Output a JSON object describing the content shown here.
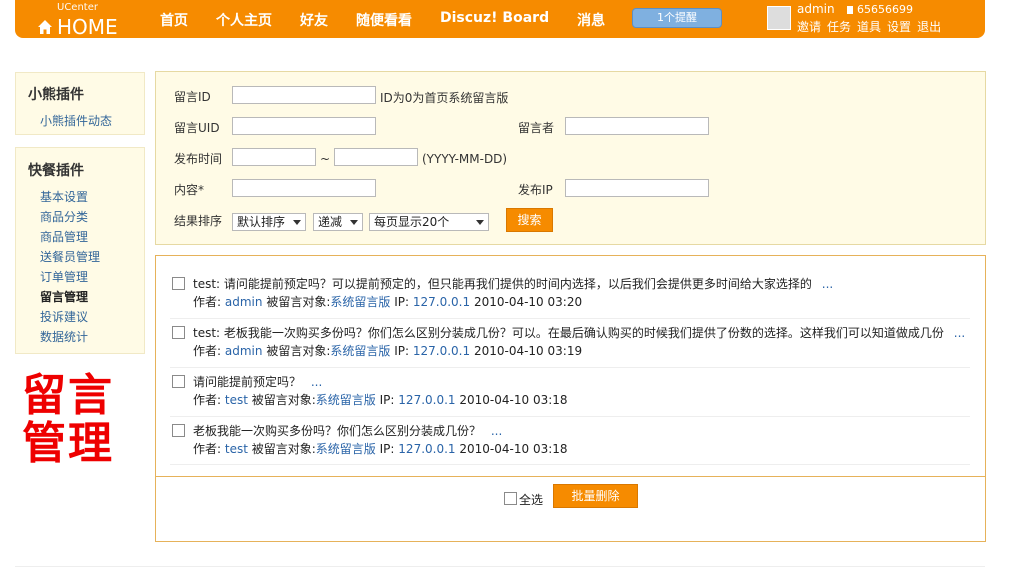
{
  "topbar": {
    "logo_small": "UCenter",
    "logo_big": "HOME",
    "nav": [
      "首页",
      "个人主页",
      "好友",
      "随便看看",
      "Discuz! Board",
      "消息"
    ],
    "notify": "1个提醒",
    "username": "admin",
    "credit": "65656699",
    "user_links": [
      "邀请",
      "任务",
      "道具",
      "设置",
      "退出"
    ]
  },
  "sidebar": {
    "box1_title": "小熊插件",
    "box1_items": [
      "小熊插件动态"
    ],
    "box2_title": "快餐插件",
    "box2_items": [
      "基本设置",
      "商品分类",
      "商品管理",
      "送餐员管理",
      "订单管理",
      "留言管理",
      "投诉建议",
      "数据统计"
    ],
    "active_item": "留言管理",
    "big_text_line1": "留言",
    "big_text_line2": "管理"
  },
  "search": {
    "msg_id_label": "留言ID",
    "msg_id_value": "",
    "msg_id_hint": "ID为0为首页系统留言版",
    "msg_uid_label": "留言UID",
    "msg_uid_value": "",
    "author_label": "留言者",
    "author_value": "",
    "time_label": "发布时间",
    "time_from": "",
    "time_sep": "~",
    "time_to": "",
    "time_hint": "(YYYY-MM-DD)",
    "content_label": "内容*",
    "content_value": "",
    "ip_label": "发布IP",
    "ip_value": "",
    "sort_label": "结果排序",
    "sort_selected": "默认排序",
    "order_selected": "递减",
    "perpage_selected": "每页显示20个",
    "search_button": "搜索"
  },
  "messages": [
    {
      "content": "test: 请问能提前预定吗？可以提前预定的，但只能再我们提供的时间内选择，以后我们会提供更多时间给大家选择的",
      "more": "...",
      "author_label": "作者:",
      "author": "admin",
      "target_label": "被留言对象:",
      "target": "系统留言版",
      "ip_label": "IP:",
      "ip": "127.0.0.1",
      "time": "2010-04-10 03:20"
    },
    {
      "content": "test: 老板我能一次购买多份吗？你们怎么区别分装成几份？可以。在最后确认购买的时候我们提供了份数的选择。这样我们可以知道做成几份",
      "more": "...",
      "author_label": "作者:",
      "author": "admin",
      "target_label": "被留言对象:",
      "target": "系统留言版",
      "ip_label": "IP:",
      "ip": "127.0.0.1",
      "time": "2010-04-10 03:19"
    },
    {
      "content": "请问能提前预定吗？",
      "more": "...",
      "author_label": "作者:",
      "author": "test",
      "target_label": "被留言对象:",
      "target": "系统留言版",
      "ip_label": "IP:",
      "ip": "127.0.0.1",
      "time": "2010-04-10 03:18"
    },
    {
      "content": "老板我能一次购买多份吗？你们怎么区别分装成几份？",
      "more": "...",
      "author_label": "作者:",
      "author": "test",
      "target_label": "被留言对象:",
      "target": "系统留言版",
      "ip_label": "IP:",
      "ip": "127.0.0.1",
      "time": "2010-04-10 03:18"
    }
  ],
  "list_footer": {
    "select_all": "全选",
    "bulk_delete": "批量删除"
  },
  "colors": {
    "accent": "#f68b00",
    "panel_bg": "#fffbe6",
    "link": "#2a64a8",
    "red": "#e00000"
  }
}
